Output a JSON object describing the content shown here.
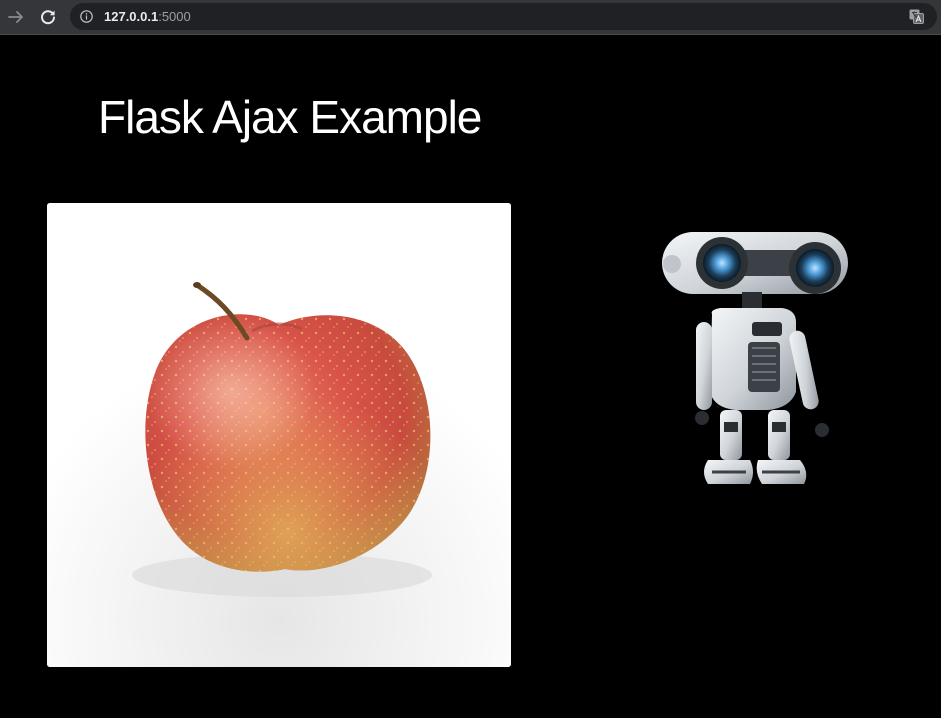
{
  "browser": {
    "url_host": "127.0.0.1",
    "url_port": ":5000",
    "icons": {
      "forward": "arrow-forward-icon",
      "reload": "reload-icon",
      "info": "info-icon",
      "translate": "translate-icon"
    }
  },
  "page": {
    "title": "Flask Ajax Example",
    "background": "#000000",
    "title_color": "#ffffff"
  },
  "images": {
    "card": "apple photo",
    "side": "robot illustration"
  }
}
